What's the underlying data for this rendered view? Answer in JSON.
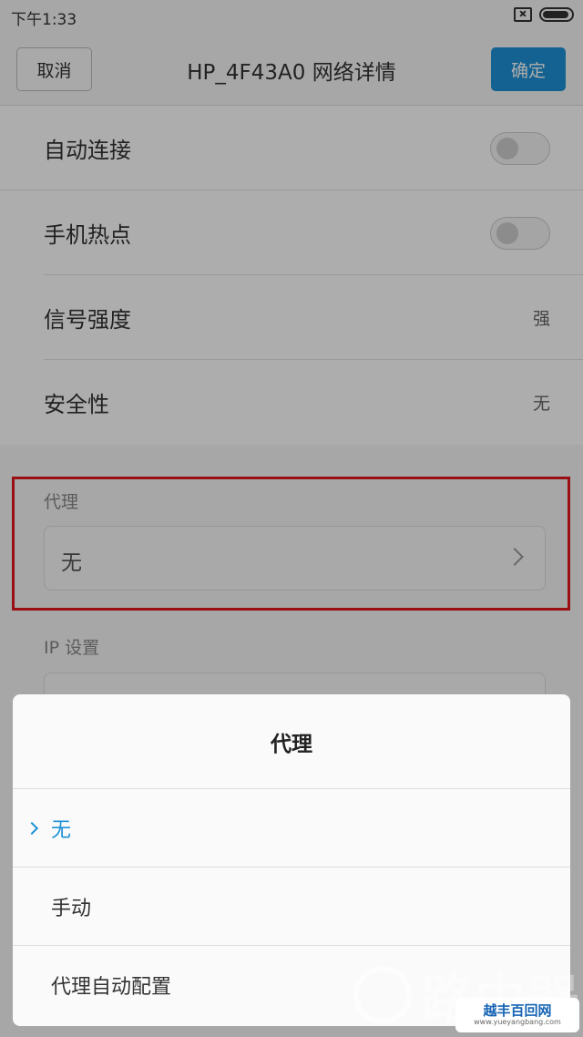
{
  "status_bar": {
    "time": "下午1:33"
  },
  "header": {
    "cancel_label": "取消",
    "title": "HP_4F43A0  网络详情",
    "confirm_label": "确定"
  },
  "settings": [
    {
      "label": "自动连接",
      "type": "toggle",
      "on": false
    },
    {
      "label": "手机热点",
      "type": "toggle",
      "on": false
    },
    {
      "label": "信号强度",
      "type": "value",
      "value": "强"
    },
    {
      "label": "安全性",
      "type": "value",
      "value": "无"
    }
  ],
  "proxy": {
    "label": "代理",
    "value": "无"
  },
  "ip": {
    "label": "IP 设置"
  },
  "dialog": {
    "title": "代理",
    "options": [
      {
        "label": "无",
        "selected": true
      },
      {
        "label": "手动",
        "selected": false
      },
      {
        "label": "代理自动配置",
        "selected": false
      }
    ]
  },
  "watermark": {
    "text": "路由器",
    "badge_title": "越丰百回网",
    "badge_url": "www.yueyangbang.com"
  },
  "colors": {
    "accent": "#1e91d6",
    "highlight": "#e0191e"
  }
}
